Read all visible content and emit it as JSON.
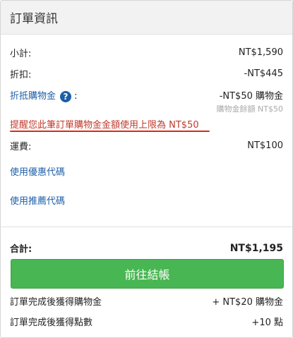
{
  "header": {
    "title": "訂單資訊"
  },
  "summary": {
    "subtotal_label": "小計:",
    "subtotal_value": "NT$1,590",
    "discount_label": "折扣:",
    "discount_value": "-NT$445",
    "credit_label": "折抵購物金",
    "credit_colon": ":",
    "credit_value": "-NT$50 購物金",
    "credit_balance": "購物金餘額 NT$50",
    "warning": "提醒您此筆訂單購物金金額使用上限為 NT$50",
    "shipping_label": "運費:",
    "shipping_value": "NT$100",
    "coupon_link": "使用優惠代碼",
    "referral_link": "使用推薦代碼"
  },
  "total": {
    "label": "合計:",
    "value": "NT$1,195"
  },
  "checkout_button": "前往結帳",
  "rewards": {
    "credit_label": "訂單完成後獲得購物金",
    "credit_value": "+ NT$20 購物金",
    "points_label": "訂單完成後獲得點數",
    "points_value": "+10 點"
  },
  "colors": {
    "link": "#1d5fa8",
    "warning": "#c0392b",
    "button": "#48b652"
  }
}
